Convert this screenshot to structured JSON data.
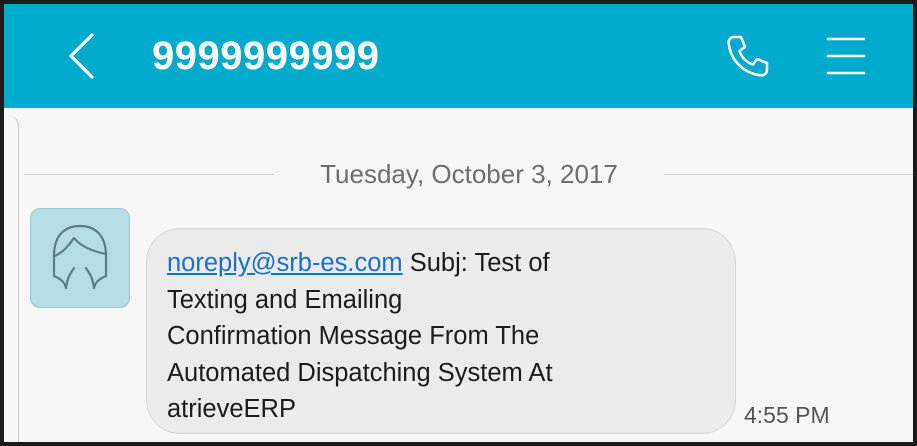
{
  "header": {
    "contact": "9999999999",
    "back_icon": "chevron-left-icon",
    "call_icon": "phone-icon",
    "menu_icon": "menu-icon",
    "background": "#00aacd"
  },
  "conversation": {
    "date_divider": "Tuesday, October 3, 2017",
    "messages": [
      {
        "sender_link": "noreply@srb-es.com",
        "text_first_line": " Subj: Test of",
        "text_lines": [
          "Texting and Emailing",
          "Confirmation Message From The",
          "Automated Dispatching System At",
          "atrieveERP"
        ],
        "time": "4:55 PM",
        "avatar_icon": "contact-avatar-icon"
      }
    ]
  }
}
